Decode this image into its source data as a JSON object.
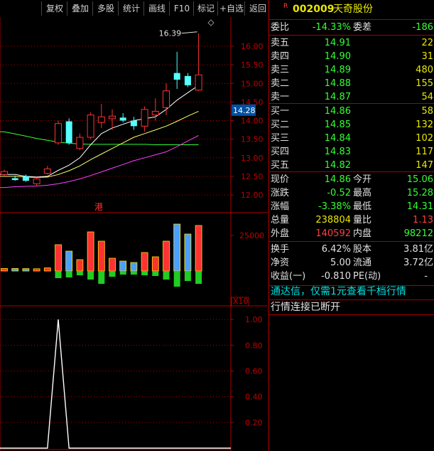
{
  "toolbar": {
    "items": [
      "复权",
      "叠加",
      "多股",
      "统计",
      "画线",
      "F10",
      "标记",
      "+自选",
      "返回"
    ]
  },
  "chart": {
    "price_ticks": [
      "16.00",
      "15.50",
      "15.00",
      "14.50",
      "14.00",
      "13.50",
      "13.00",
      "12.50",
      "12.00"
    ],
    "current_price_tag": "14.28",
    "high_annotation": "16.39",
    "marker_label": "港",
    "volume_tick": "25000",
    "volume_unit": "X10",
    "indicator_ticks": [
      "1.00",
      "0.80",
      "0.60",
      "0.40",
      "0.20"
    ],
    "colors": {
      "up": "#ff3232",
      "down": "#54ffff",
      "ma5": "#ffffff",
      "ma10": "#ffff66",
      "ma20": "#ff40ff",
      "ma60": "#33ff33",
      "grid": "#b00000"
    }
  },
  "stock": {
    "badge": "R",
    "code": "002009",
    "name": "天奇股份"
  },
  "order_ratio": {
    "label": "委比",
    "value": "-14.33%",
    "diff_label": "委差",
    "diff_value": "-186"
  },
  "sell_levels": [
    {
      "label": "卖五",
      "price": "14.91",
      "volume": "22"
    },
    {
      "label": "卖四",
      "price": "14.90",
      "volume": "31"
    },
    {
      "label": "卖三",
      "price": "14.89",
      "volume": "480"
    },
    {
      "label": "卖二",
      "price": "14.88",
      "volume": "155"
    },
    {
      "label": "卖一",
      "price": "14.87",
      "volume": "54"
    }
  ],
  "buy_levels": [
    {
      "label": "买一",
      "price": "14.86",
      "volume": "58"
    },
    {
      "label": "买二",
      "price": "14.85",
      "volume": "132"
    },
    {
      "label": "买三",
      "price": "14.84",
      "volume": "102"
    },
    {
      "label": "买四",
      "price": "14.83",
      "volume": "117"
    },
    {
      "label": "买五",
      "price": "14.82",
      "volume": "147"
    }
  ],
  "quote": {
    "current_label": "现价",
    "current": "14.86",
    "open_label": "今开",
    "open": "15.06",
    "change_label": "涨跌",
    "change": "-0.52",
    "high_label": "最高",
    "high": "15.28",
    "pct_label": "涨幅",
    "pct": "-3.38%",
    "low_label": "最低",
    "low": "14.31",
    "total_label": "总量",
    "total": "238804",
    "ratio_label": "量比",
    "ratio": "1.13",
    "outer_label": "外盘",
    "outer": "140592",
    "inner_label": "内盘",
    "inner": "98212"
  },
  "fundamentals": {
    "turnover_label": "换手",
    "turnover": "6.42%",
    "equity_label": "股本",
    "equity": "3.81亿",
    "nav_label": "净资",
    "nav": "5.00",
    "float_label": "流通",
    "float": "3.72亿",
    "eps_label": "收益(一)",
    "eps": "-0.810",
    "pe_label": "PE(动)",
    "pe": "-"
  },
  "notices": {
    "promo": "通达信，仅需1元查看千档行情",
    "status": "行情连接已断开"
  },
  "chart_data": {
    "type": "candlestick",
    "price_axis": {
      "min": 12.0,
      "max": 16.0
    },
    "candles": [
      {
        "o": 12.55,
        "c": 12.63,
        "h": 12.68,
        "l": 12.5
      },
      {
        "o": 12.45,
        "c": 12.4,
        "h": 12.52,
        "l": 12.38
      },
      {
        "o": 12.5,
        "c": 12.38,
        "h": 12.55,
        "l": 12.35
      },
      {
        "o": 12.3,
        "c": 12.43,
        "h": 12.47,
        "l": 12.25
      },
      {
        "o": 12.58,
        "c": 12.7,
        "h": 12.78,
        "l": 12.55
      },
      {
        "o": 13.4,
        "c": 13.92,
        "h": 14.0,
        "l": 13.35
      },
      {
        "o": 13.98,
        "c": 13.4,
        "h": 14.06,
        "l": 13.35
      },
      {
        "o": 13.25,
        "c": 13.55,
        "h": 13.65,
        "l": 13.2
      },
      {
        "o": 13.55,
        "c": 14.15,
        "h": 14.22,
        "l": 13.5
      },
      {
        "o": 13.95,
        "c": 14.1,
        "h": 14.45,
        "l": 13.8
      },
      {
        "o": 14.05,
        "c": 14.12,
        "h": 14.3,
        "l": 13.75
      },
      {
        "o": 14.08,
        "c": 14.0,
        "h": 14.2,
        "l": 13.95
      },
      {
        "o": 14.0,
        "c": 13.85,
        "h": 14.1,
        "l": 13.75
      },
      {
        "o": 13.85,
        "c": 14.3,
        "h": 14.38,
        "l": 13.7
      },
      {
        "o": 14.15,
        "c": 14.25,
        "h": 14.6,
        "l": 14.0
      },
      {
        "o": 14.35,
        "c": 14.8,
        "h": 15.0,
        "l": 14.15
      },
      {
        "o": 15.28,
        "c": 15.1,
        "h": 15.85,
        "l": 14.85
      },
      {
        "o": 15.2,
        "c": 14.95,
        "h": 15.28,
        "l": 14.9
      },
      {
        "o": 14.82,
        "c": 15.23,
        "h": 16.35,
        "l": 14.8
      }
    ],
    "ma5": [
      12.55,
      12.55,
      12.5,
      12.48,
      12.5,
      12.66,
      12.8,
      13.0,
      13.35,
      13.65,
      13.8,
      13.9,
      14.0,
      14.05,
      14.1,
      14.3,
      14.55,
      14.75,
      14.95
    ],
    "ma10": [
      12.5,
      12.5,
      12.48,
      12.47,
      12.48,
      12.55,
      12.65,
      12.78,
      12.95,
      13.1,
      13.25,
      13.4,
      13.55,
      13.65,
      13.75,
      13.85,
      13.98,
      14.12,
      14.25
    ],
    "ma20": [
      12.2,
      12.22,
      12.23,
      12.24,
      12.26,
      12.3,
      12.36,
      12.43,
      12.52,
      12.62,
      12.72,
      12.82,
      12.92,
      13.0,
      13.08,
      13.16,
      13.3,
      13.45,
      13.6
    ],
    "ma60": [
      13.7,
      13.64,
      13.58,
      13.52,
      13.47,
      13.42,
      13.39,
      13.37,
      13.36,
      13.36,
      13.36,
      13.36,
      13.36,
      13.36,
      13.35,
      13.35,
      13.35,
      13.35,
      13.35
    ],
    "volume_axis": {
      "max": 40000
    },
    "volume": [
      1800,
      1800,
      1700,
      1600,
      2200,
      18500,
      14000,
      8000,
      27500,
      21000,
      9000,
      7000,
      6000,
      13000,
      10000,
      21000,
      33000,
      26000,
      32000
    ],
    "volume_down": [
      0,
      0,
      0,
      0,
      0,
      5000,
      4500,
      3000,
      6000,
      9000,
      4000,
      2500,
      2500,
      3000,
      3500,
      6000,
      11000,
      7000,
      9000
    ],
    "indicator_axis": {
      "min": 0,
      "max": 1.1
    },
    "indicator": [
      0,
      0,
      0,
      0,
      0,
      1.0,
      0,
      0,
      0,
      0,
      0,
      0,
      0,
      0,
      0,
      0,
      0,
      0,
      0
    ]
  }
}
